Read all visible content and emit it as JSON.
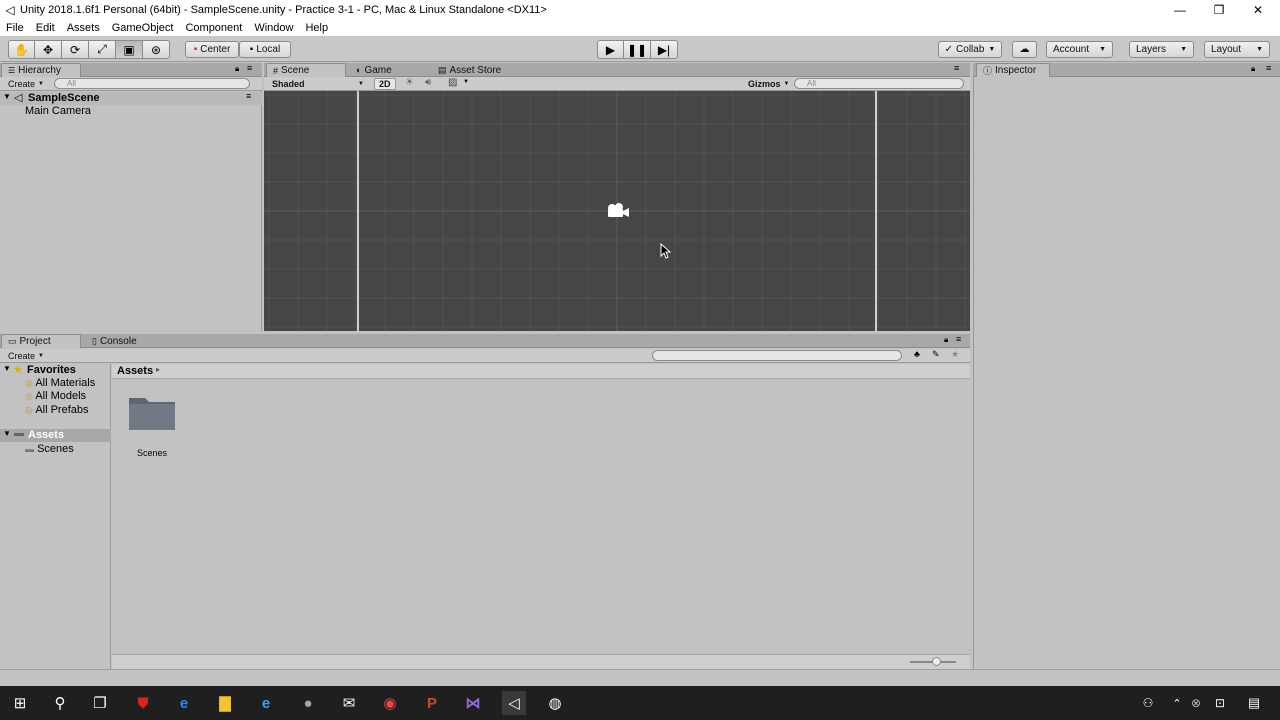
{
  "window": {
    "title": "Unity 2018.1.6f1 Personal (64bit) - SampleScene.unity - Practice 3-1 - PC, Mac & Linux Standalone <DX11>",
    "controls": {
      "minimize": "—",
      "restore": "❐",
      "close": "✕"
    }
  },
  "menu": [
    "File",
    "Edit",
    "Assets",
    "GameObject",
    "Component",
    "Window",
    "Help"
  ],
  "toolbar": {
    "tools": [
      "hand-icon",
      "move-icon",
      "rotate-icon",
      "scale-icon",
      "rect-icon",
      "transform-icon"
    ],
    "pivot_label": "Center",
    "space_label": "Local",
    "collab_label": "Collab",
    "account_label": "Account",
    "layers_label": "Layers",
    "layout_label": "Layout"
  },
  "hierarchy": {
    "tab": "Hierarchy",
    "create_label": "Create",
    "search_placeholder": "All",
    "scene_name": "SampleScene",
    "items": [
      "Main Camera"
    ]
  },
  "scene_view": {
    "tabs": [
      "Scene",
      "Game",
      "Asset Store"
    ],
    "shading_mode": "Shaded",
    "mode_2d": "2D",
    "gizmos_label": "Gizmos",
    "search_placeholder": "All"
  },
  "inspector": {
    "tab": "Inspector"
  },
  "project": {
    "tabs": [
      "Project",
      "Console"
    ],
    "create_label": "Create",
    "favorites_label": "Favorites",
    "favorites": [
      "All Materials",
      "All Models",
      "All Prefabs"
    ],
    "assets_label": "Assets",
    "asset_folders": [
      "Scenes"
    ],
    "breadcrumb": "Assets",
    "grid_items": [
      "Scenes"
    ]
  },
  "colors": {
    "scene_bg": "#464646",
    "panel_bg": "#c2c2c2",
    "selected_row": "#a8a8a8",
    "taskbar_bg": "#1f1f1f"
  }
}
